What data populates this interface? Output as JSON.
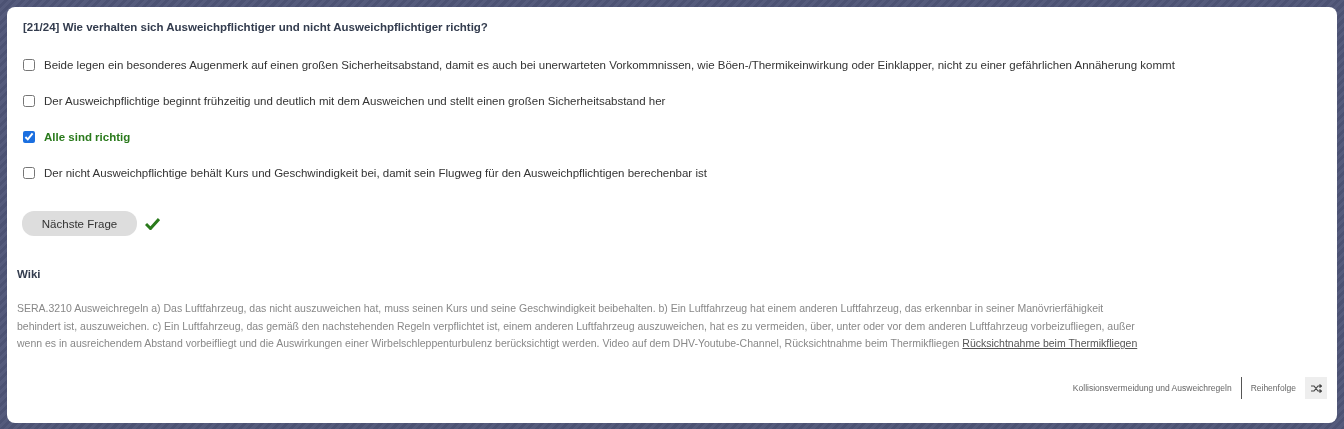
{
  "question": {
    "counter": "[21/24]",
    "text": "Wie verhalten sich Ausweichpflichtiger und nicht Ausweichpflichtiger richtig?"
  },
  "answers": [
    {
      "label": "Beide legen ein besonderes Augenmerk auf einen großen Sicherheitsabstand, damit es auch bei unerwarteten Vorkommnissen, wie Böen-/Thermikeinwirkung oder Einklapper, nicht zu einer gefährlichen Annäherung kommt",
      "checked": false,
      "correct": false
    },
    {
      "label": "Der Ausweichpflichtige beginnt frühzeitig und deutlich mit dem Ausweichen und stellt einen großen Sicherheitsabstand her",
      "checked": false,
      "correct": false
    },
    {
      "label": "Alle sind richtig",
      "checked": true,
      "correct": true
    },
    {
      "label": "Der nicht Ausweichpflichtige behält Kurs und Geschwindigkeit bei, damit sein Flugweg für den Ausweichpflichtigen berechenbar ist",
      "checked": false,
      "correct": false
    }
  ],
  "next_button": "Nächste Frage",
  "answered_correctly": true,
  "wiki": {
    "heading": "Wiki",
    "text": "SERA.3210 Ausweichregeln a) Das Luftfahrzeug, das nicht auszuweichen hat, muss seinen Kurs und seine Geschwindigkeit beibehalten. b) Ein Luftfahrzeug hat einem anderen Luftfahrzeug, das erkennbar in seiner Manövrierfähigkeit behindert ist, auszuweichen. c) Ein Luftfahrzeug, das gemäß den nachstehenden Regeln verpflichtet ist, einem anderen Luftfahrzeug auszuweichen, hat es zu vermeiden, über, unter oder vor dem anderen Luftfahrzeug vorbeizufliegen, außer wenn es in ausreichendem Abstand vorbeifliegt und die Auswirkungen einer Wirbelschleppenturbulenz berücksichtigt werden. Video auf dem DHV-Youtube-Channel, Rücksichtnahme beim Thermikfliegen",
    "link": "Rücksichtnahme beim Thermikfliegen"
  },
  "footer": {
    "category": "Kollisionsvermeidung und Ausweichregeln",
    "order_label": "Reihenfolge"
  }
}
